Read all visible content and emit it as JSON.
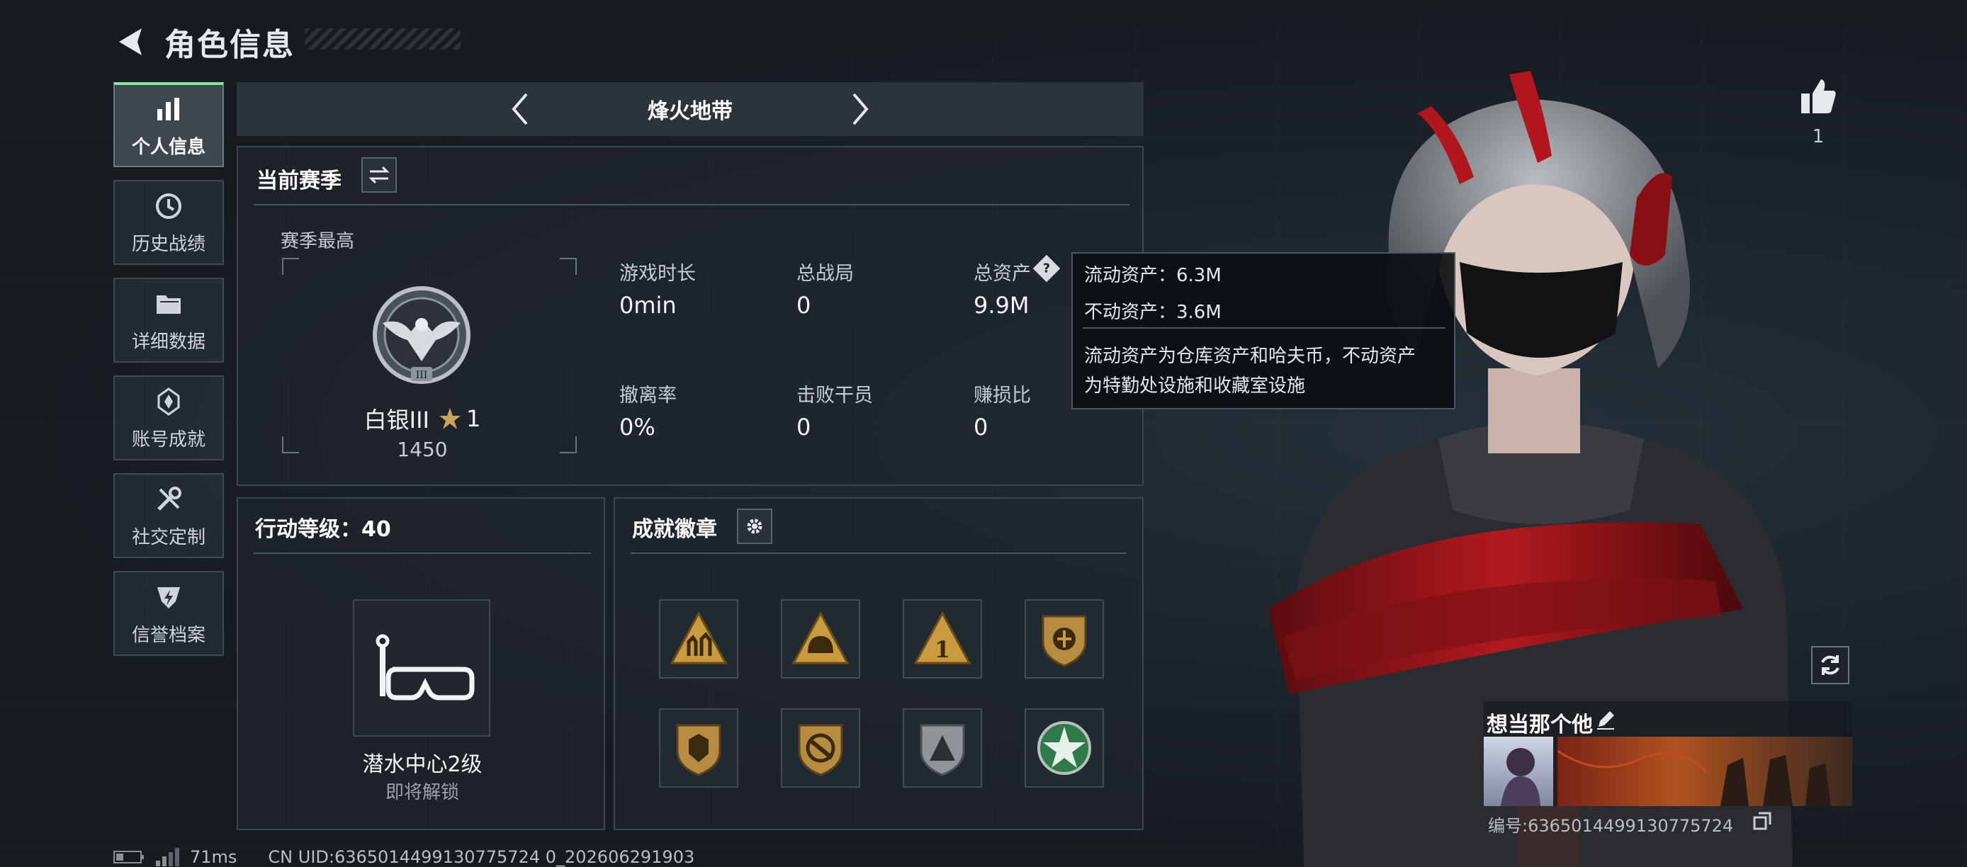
{
  "header": {
    "title": "角色信息"
  },
  "sidebar": {
    "items": [
      {
        "label": "个人信息",
        "icon": "bar-chart-icon",
        "active": true
      },
      {
        "label": "历史战绩",
        "icon": "history-clock-icon"
      },
      {
        "label": "详细数据",
        "icon": "folder-icon"
      },
      {
        "label": "账号成就",
        "icon": "achievement-icon"
      },
      {
        "label": "社交定制",
        "icon": "tools-icon"
      },
      {
        "label": "信誉档案",
        "icon": "shield-bolt-icon"
      }
    ]
  },
  "mode": {
    "title": "烽火地带"
  },
  "season": {
    "title": "当前赛季",
    "best_label": "赛季最高",
    "rank_name": "白银III",
    "rank_stars": "1",
    "rank_score": "1450",
    "stats": [
      {
        "label": "游戏时长",
        "value": "0min"
      },
      {
        "label": "总战局",
        "value": "0"
      },
      {
        "label": "总资产",
        "value": "9.9M"
      },
      {
        "label": "撤离率",
        "value": "0%"
      },
      {
        "label": "击败干员",
        "value": "0"
      },
      {
        "label": "赚损比",
        "value": "0"
      }
    ]
  },
  "tooltip": {
    "line1": "流动资产：6.3M",
    "line2": "不动资产：3.6M",
    "desc1": "流动资产为仓库资产和哈夫币，不动资产",
    "desc2": "为特勤处设施和收藏室设施"
  },
  "level": {
    "title": "行动等级：40",
    "facility_name": "潜水中心2级",
    "facility_status": "即将解锁"
  },
  "badges": {
    "title": "成就徽章",
    "items": [
      "triangle-soldiers-badge-icon",
      "triangle-helmet-badge-icon",
      "triangle-number-one-badge-icon",
      "shield-emblem-badge-icon",
      "shield-lion-badge-icon",
      "shield-rifle-badge-icon",
      "shield-pyramid-badge-icon",
      "green-star-badge-icon"
    ]
  },
  "profile": {
    "likes": "1",
    "nickname": "想当那个他",
    "id_text": "编号:6365014499130775724"
  },
  "status_bar": {
    "ping": "71ms",
    "uid": "CN UID:6365014499130775724 0_202606291903"
  },
  "colors": {
    "accent": "#8ee2a0",
    "bg": "#1b2025",
    "gold": "#c9a45a"
  }
}
